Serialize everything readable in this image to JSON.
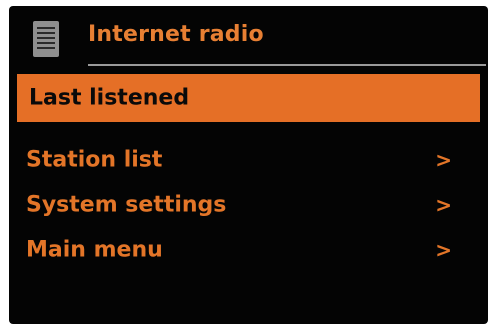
{
  "header": {
    "icon": "menu-list-icon",
    "title": "Internet radio"
  },
  "colors": {
    "accent": "#e56f26",
    "text": "#e37528",
    "background": "#040404"
  },
  "menu": {
    "selected_index": 0,
    "items": [
      {
        "label": "Last listened",
        "arrow": ""
      },
      {
        "label": "Station list",
        "arrow": ">"
      },
      {
        "label": "System settings",
        "arrow": ">"
      },
      {
        "label": "Main menu",
        "arrow": ">"
      }
    ]
  }
}
